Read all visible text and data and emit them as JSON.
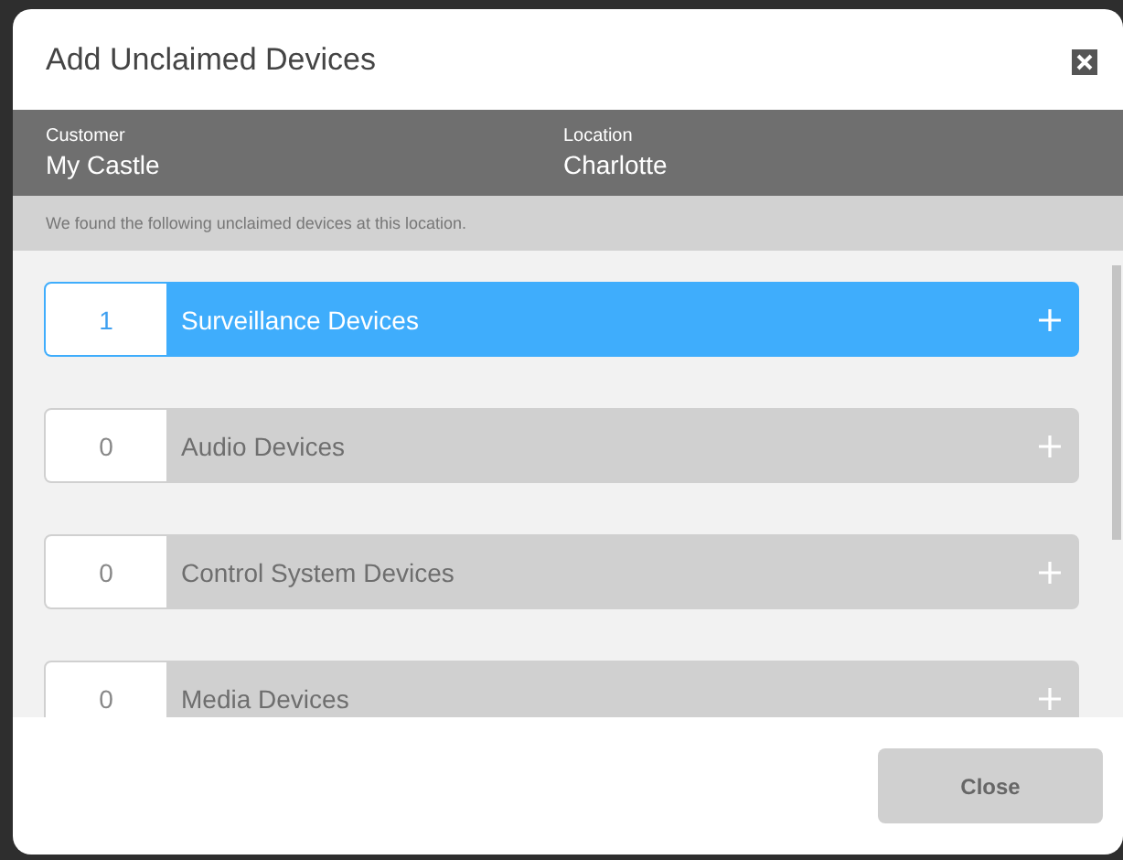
{
  "dialog": {
    "title": "Add Unclaimed Devices"
  },
  "info": {
    "customer_label": "Customer",
    "customer": "My Castle",
    "location_label": "Location",
    "location": "Charlotte"
  },
  "message": "We found the following unclaimed devices at this location.",
  "categories": [
    {
      "count": "1",
      "name": "Surveillance Devices",
      "selected": true
    },
    {
      "count": "0",
      "name": "Audio Devices",
      "selected": false
    },
    {
      "count": "0",
      "name": "Control System Devices",
      "selected": false
    },
    {
      "count": "0",
      "name": "Media Devices",
      "selected": false
    }
  ],
  "buttons": [
    "Close"
  ]
}
